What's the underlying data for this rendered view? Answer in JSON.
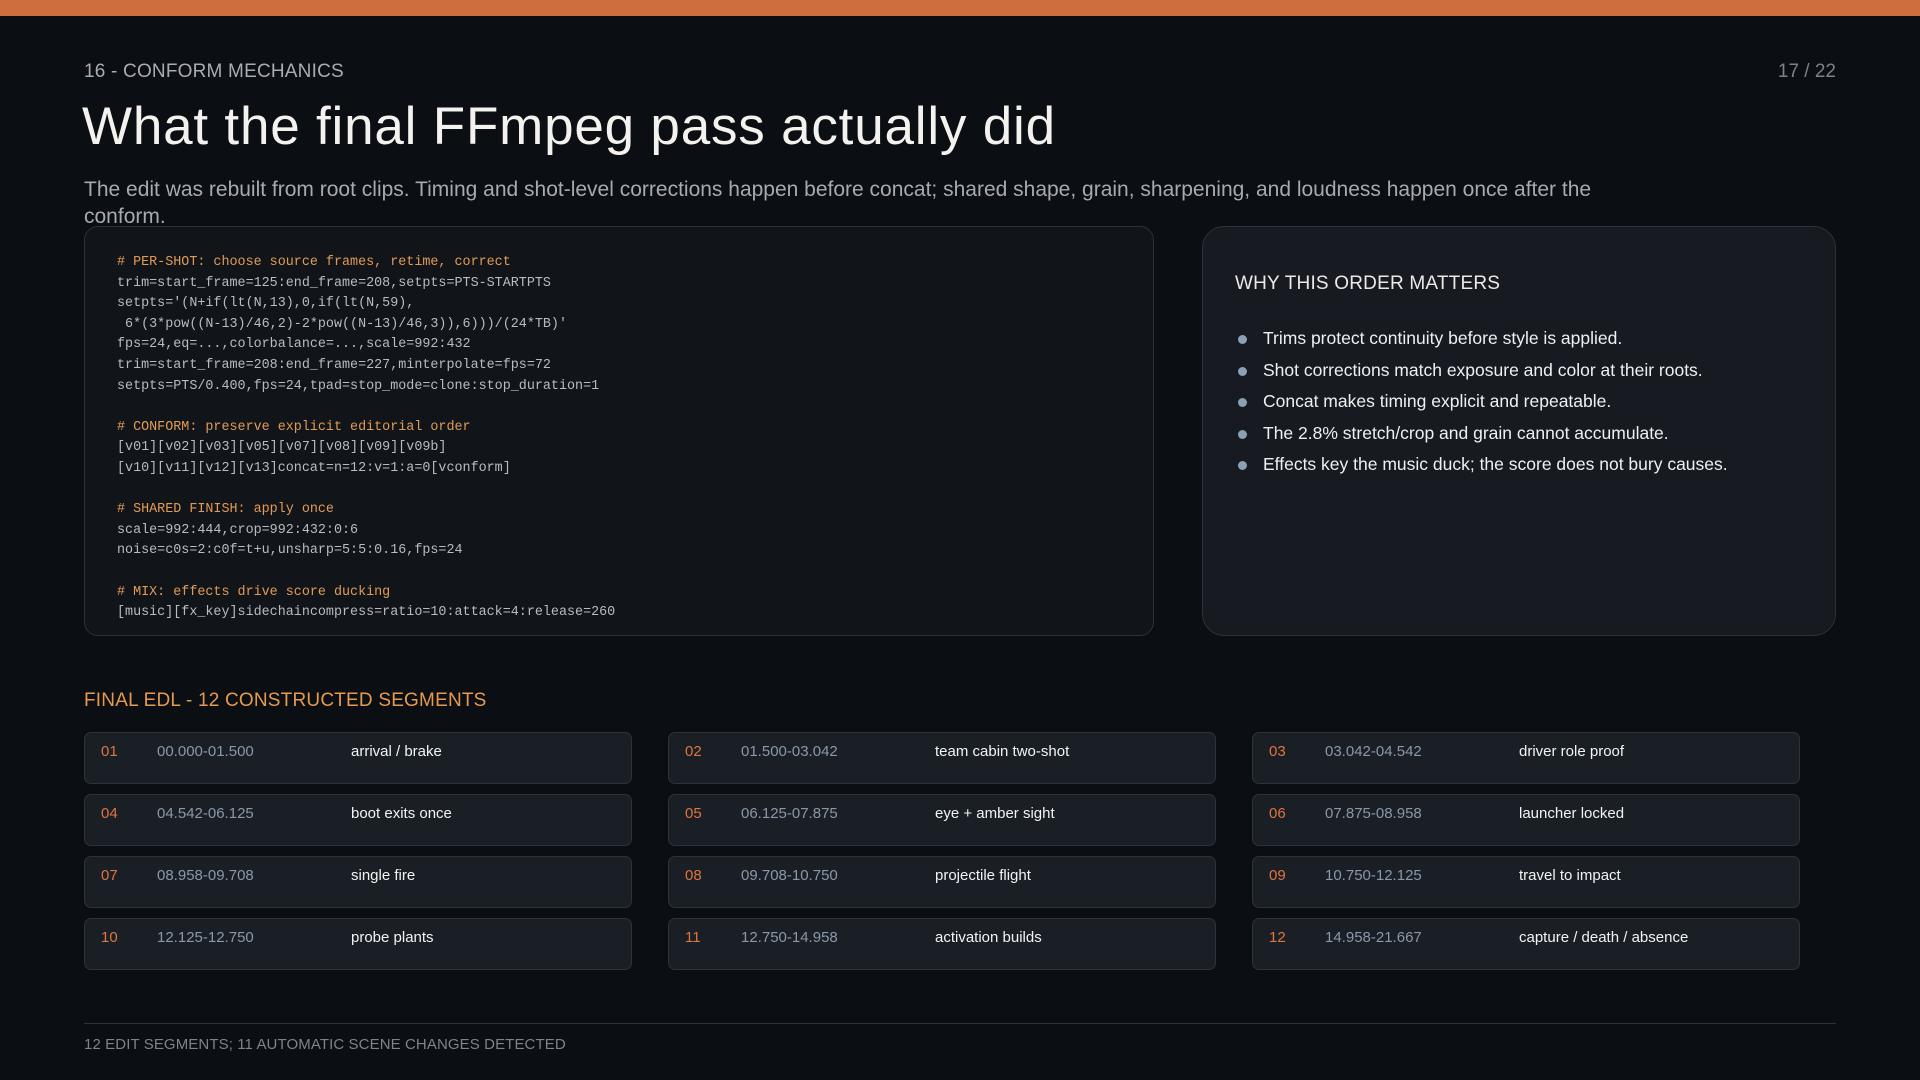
{
  "header": {
    "section_label": "16 - CONFORM MECHANICS",
    "page_number": "17 / 22",
    "title": "What the final FFmpeg pass actually did",
    "subtitle": "The edit was rebuilt from root clips. Timing and shot-level corrections happen before concat; shared shape, grain, sharpening, and loudness happen once after the conform."
  },
  "code": {
    "lines": [
      {
        "kind": "comment",
        "text": "# PER-SHOT: choose source frames, retime, correct"
      },
      {
        "kind": "code",
        "text": "trim=start_frame=125:end_frame=208,setpts=PTS-STARTPTS"
      },
      {
        "kind": "code",
        "text": "setpts='(N+if(lt(N,13),0,if(lt(N,59),"
      },
      {
        "kind": "code",
        "text": " 6*(3*pow((N-13)/46,2)-2*pow((N-13)/46,3)),6)))/(24*TB)'"
      },
      {
        "kind": "code",
        "text": "fps=24,eq=...,colorbalance=...,scale=992:432"
      },
      {
        "kind": "code",
        "text": "trim=start_frame=208:end_frame=227,minterpolate=fps=72"
      },
      {
        "kind": "code",
        "text": "setpts=PTS/0.400,fps=24,tpad=stop_mode=clone:stop_duration=1"
      },
      {
        "kind": "blank",
        "text": ""
      },
      {
        "kind": "comment",
        "text": "# CONFORM: preserve explicit editorial order"
      },
      {
        "kind": "code",
        "text": "[v01][v02][v03][v05][v07][v08][v09][v09b]"
      },
      {
        "kind": "code",
        "text": "[v10][v11][v12][v13]concat=n=12:v=1:a=0[vconform]"
      },
      {
        "kind": "blank",
        "text": ""
      },
      {
        "kind": "comment",
        "text": "# SHARED FINISH: apply once"
      },
      {
        "kind": "code",
        "text": "scale=992:444,crop=992:432:0:6"
      },
      {
        "kind": "code",
        "text": "noise=c0s=2:c0f=t+u,unsharp=5:5:0.16,fps=24"
      },
      {
        "kind": "blank",
        "text": ""
      },
      {
        "kind": "comment",
        "text": "# MIX: effects drive score ducking"
      },
      {
        "kind": "code",
        "text": "[music][fx_key]sidechaincompress=ratio=10:attack=4:release=260"
      }
    ]
  },
  "why": {
    "title": "WHY THIS ORDER MATTERS",
    "items": [
      "Trims protect continuity before style is applied.",
      "Shot corrections match exposure and color at their roots.",
      "Concat makes timing explicit and repeatable.",
      "The 2.8% stretch/crop and grain cannot accumulate.",
      "Effects key the music duck; the score does not bury causes."
    ]
  },
  "edl": {
    "title": "FINAL EDL - 12 CONSTRUCTED SEGMENTS",
    "segments": [
      {
        "num": "01",
        "time": "00.000-01.500",
        "label": "arrival / brake"
      },
      {
        "num": "02",
        "time": "01.500-03.042",
        "label": "team cabin two-shot"
      },
      {
        "num": "03",
        "time": "03.042-04.542",
        "label": "driver role proof"
      },
      {
        "num": "04",
        "time": "04.542-06.125",
        "label": "boot exits once"
      },
      {
        "num": "05",
        "time": "06.125-07.875",
        "label": "eye + amber sight"
      },
      {
        "num": "06",
        "time": "07.875-08.958",
        "label": "launcher locked"
      },
      {
        "num": "07",
        "time": "08.958-09.708",
        "label": "single fire"
      },
      {
        "num": "08",
        "time": "09.708-10.750",
        "label": "projectile flight"
      },
      {
        "num": "09",
        "time": "10.750-12.125",
        "label": "travel to impact"
      },
      {
        "num": "10",
        "time": "12.125-12.750",
        "label": "probe plants"
      },
      {
        "num": "11",
        "time": "12.750-14.958",
        "label": "activation builds"
      },
      {
        "num": "12",
        "time": "14.958-21.667",
        "label": "capture / death / absence"
      }
    ]
  },
  "footer": {
    "text": "12 EDIT SEGMENTS; 11 AUTOMATIC SCENE CHANGES DETECTED"
  },
  "colors": {
    "accent_bar": "#cd6e3c",
    "comment": "#e19a57",
    "edl_title": "#e59a50",
    "segment_number": "#e0743f",
    "background": "#0b0e12"
  }
}
